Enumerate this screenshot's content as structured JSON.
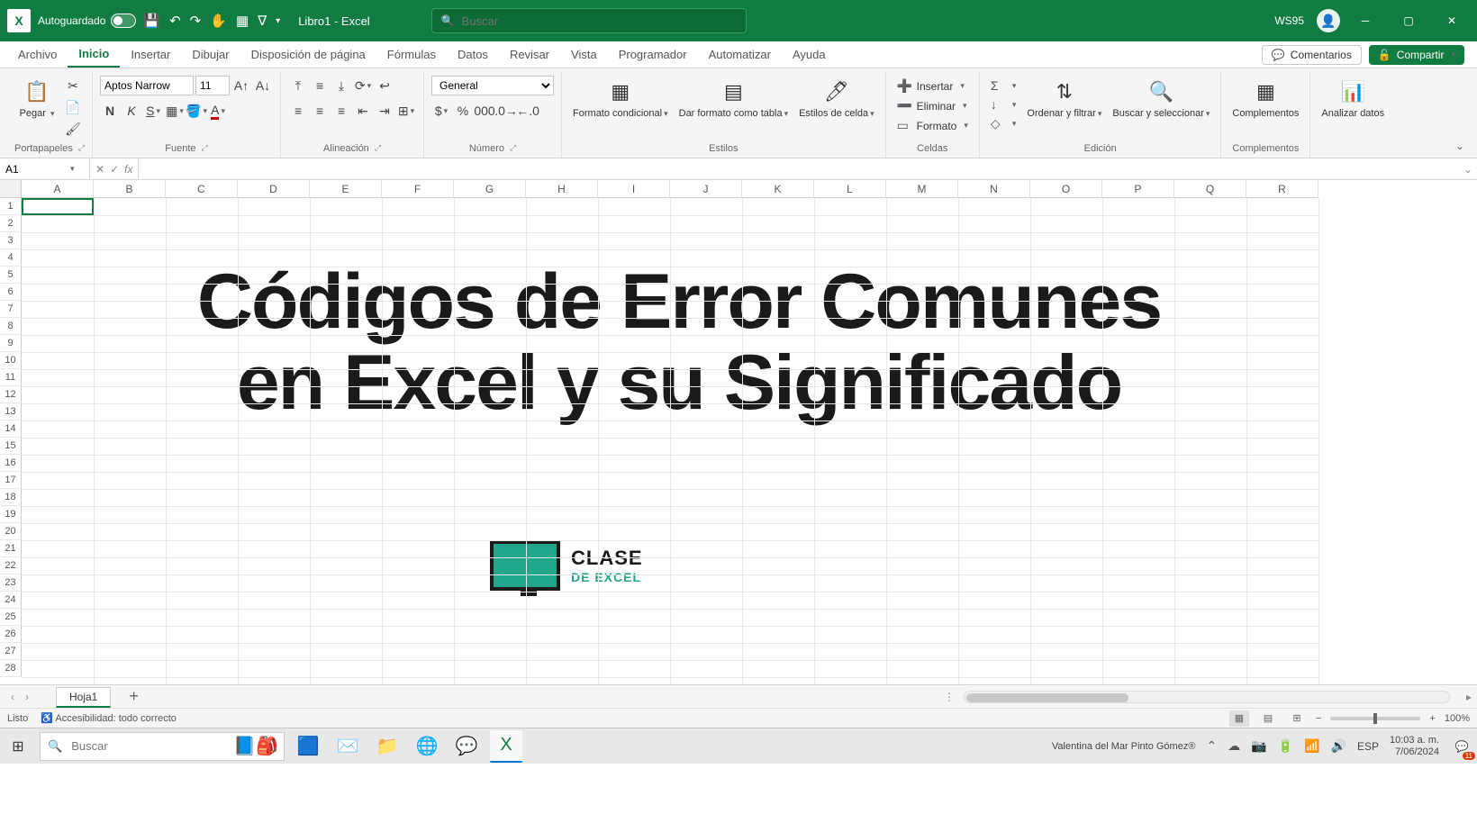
{
  "titlebar": {
    "autosave_label": "Autoguardado",
    "doc_name": "Libro1 - Excel",
    "search_placeholder": "Buscar",
    "user_short": "WS95"
  },
  "tabs": [
    "Archivo",
    "Inicio",
    "Insertar",
    "Dibujar",
    "Disposición de página",
    "Fórmulas",
    "Datos",
    "Revisar",
    "Vista",
    "Programador",
    "Automatizar",
    "Ayuda"
  ],
  "active_tab_index": 1,
  "comments_label": "Comentarios",
  "share_label": "Compartir",
  "ribbon": {
    "clipboard": {
      "paste": "Pegar",
      "label": "Portapapeles"
    },
    "font": {
      "name": "Aptos Narrow",
      "size": "11",
      "label": "Fuente"
    },
    "align": {
      "label": "Alineación"
    },
    "number": {
      "format": "General",
      "label": "Número"
    },
    "styles": {
      "cond": "Formato condicional",
      "table": "Dar formato como tabla",
      "cell": "Estilos de celda",
      "label": "Estilos"
    },
    "cells": {
      "insert": "Insertar",
      "delete": "Eliminar",
      "format": "Formato",
      "label": "Celdas"
    },
    "editing": {
      "sort": "Ordenar y filtrar",
      "find": "Buscar y seleccionar",
      "label": "Edición"
    },
    "addins": {
      "btn": "Complementos",
      "label": "Complementos"
    },
    "analyze": {
      "btn": "Analizar datos"
    }
  },
  "name_box": "A1",
  "columns": [
    "A",
    "B",
    "C",
    "D",
    "E",
    "F",
    "G",
    "H",
    "I",
    "J",
    "K",
    "L",
    "M",
    "N",
    "O",
    "P",
    "Q",
    "R"
  ],
  "row_count": 28,
  "overlay": {
    "line1": "Códigos de Error Comunes",
    "line2": "en Excel y su Significado",
    "logo_top": "CLASE",
    "logo_bottom": "DE EXCEL"
  },
  "sheet_tab": "Hoja1",
  "status": {
    "ready": "Listo",
    "access": "Accesibilidad: todo correcto",
    "zoom": "100%"
  },
  "taskbar": {
    "search_placeholder": "Buscar",
    "user": "Valentina del Mar Pinto Gómez®",
    "lang": "ESP",
    "time": "10:03 a. m.",
    "date": "7/06/2024",
    "notif_count": "11"
  }
}
